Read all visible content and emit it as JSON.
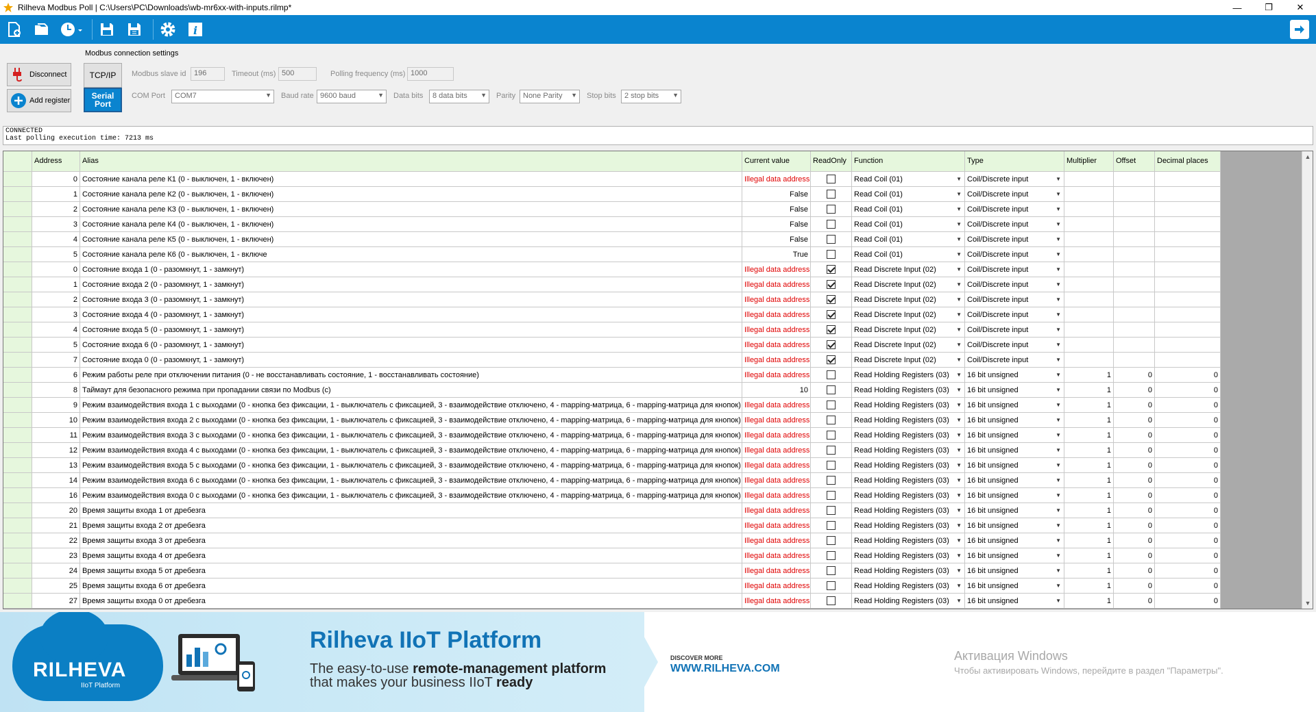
{
  "window": {
    "title": "Rilheva Modbus Poll | C:\\Users\\PC\\Downloads\\wb-mr6xx-with-inputs.rilmp*",
    "minimize": "—",
    "maximize": "❐",
    "close": "✕"
  },
  "toolbar": {
    "icons": [
      "new-document-icon",
      "open-folder-icon",
      "recent-clock-icon",
      "save-icon",
      "save-as-icon",
      "settings-gear-icon",
      "info-icon",
      "exit-arrow-icon"
    ],
    "accent": "#0a84cf"
  },
  "actions": {
    "disconnect": "Disconnect",
    "add_register": "Add register"
  },
  "connection": {
    "group_title": "Modbus connection settings",
    "tcp_ip": "TCP/IP",
    "serial_port": "Serial Port",
    "slave_id_label": "Modbus slave id",
    "slave_id_value": "196",
    "timeout_label": "Timeout (ms)",
    "timeout_value": "500",
    "polling_label": "Polling frequency (ms)",
    "polling_value": "1000",
    "com_port_label": "COM Port",
    "com_port_value": "COM7",
    "baud_label": "Baud rate",
    "baud_value": "9600 baud",
    "data_bits_label": "Data bits",
    "data_bits_value": "8 data bits",
    "parity_label": "Parity",
    "parity_value": "None Parity",
    "stop_bits_label": "Stop bits",
    "stop_bits_value": "2 stop bits"
  },
  "status": {
    "line1": "CONNECTED",
    "line2": "Last polling execution time: 7213 ms"
  },
  "grid": {
    "headers": {
      "address": "Address",
      "alias": "Alias",
      "current": "Current value",
      "readonly": "ReadOnly",
      "function": "Function",
      "type": "Type",
      "multiplier": "Multiplier",
      "offset": "Offset",
      "decimal": "Decimal places"
    },
    "rows": [
      {
        "address": "0",
        "alias": "Состояние канала реле К1 (0 - выключен, 1 - включен)",
        "value": "Illegal data address",
        "error": true,
        "readonly": false,
        "function": "Read Coil (01)",
        "type": "Coil/Discrete input",
        "multiplier": "",
        "offset": "",
        "decimal": ""
      },
      {
        "address": "1",
        "alias": "Состояние канала реле К2 (0 - выключен, 1 - включен)",
        "value": "False",
        "error": false,
        "readonly": false,
        "function": "Read Coil (01)",
        "type": "Coil/Discrete input",
        "multiplier": "",
        "offset": "",
        "decimal": ""
      },
      {
        "address": "2",
        "alias": "Состояние канала реле К3 (0 - выключен, 1 - включен)",
        "value": "False",
        "error": false,
        "readonly": false,
        "function": "Read Coil (01)",
        "type": "Coil/Discrete input",
        "multiplier": "",
        "offset": "",
        "decimal": ""
      },
      {
        "address": "3",
        "alias": "Состояние канала реле К4 (0 - выключен, 1 - включен)",
        "value": "False",
        "error": false,
        "readonly": false,
        "function": "Read Coil (01)",
        "type": "Coil/Discrete input",
        "multiplier": "",
        "offset": "",
        "decimal": ""
      },
      {
        "address": "4",
        "alias": "Состояние канала реле К5 (0 - выключен, 1 - включен)",
        "value": "False",
        "error": false,
        "readonly": false,
        "function": "Read Coil (01)",
        "type": "Coil/Discrete input",
        "multiplier": "",
        "offset": "",
        "decimal": ""
      },
      {
        "address": "5",
        "alias": "Состояние канала реле К6 (0 - выключен, 1 - включе",
        "value": "True",
        "error": false,
        "readonly": false,
        "function": "Read Coil (01)",
        "type": "Coil/Discrete input",
        "multiplier": "",
        "offset": "",
        "decimal": ""
      },
      {
        "address": "0",
        "alias": "Состояние входа 1 (0 - разомкнут, 1 - замкнут)",
        "value": "Illegal data address",
        "error": true,
        "readonly": true,
        "function": "Read Discrete Input (02)",
        "type": "Coil/Discrete input",
        "multiplier": "",
        "offset": "",
        "decimal": ""
      },
      {
        "address": "1",
        "alias": "Состояние входа 2 (0 - разомкнут, 1 - замкнут)",
        "value": "Illegal data address",
        "error": true,
        "readonly": true,
        "function": "Read Discrete Input (02)",
        "type": "Coil/Discrete input",
        "multiplier": "",
        "offset": "",
        "decimal": ""
      },
      {
        "address": "2",
        "alias": "Состояние входа 3 (0 - разомкнут, 1 - замкнут)",
        "value": "Illegal data address",
        "error": true,
        "readonly": true,
        "function": "Read Discrete Input (02)",
        "type": "Coil/Discrete input",
        "multiplier": "",
        "offset": "",
        "decimal": ""
      },
      {
        "address": "3",
        "alias": "Состояние входа 4 (0 - разомкнут, 1 - замкнут)",
        "value": "Illegal data address",
        "error": true,
        "readonly": true,
        "function": "Read Discrete Input (02)",
        "type": "Coil/Discrete input",
        "multiplier": "",
        "offset": "",
        "decimal": ""
      },
      {
        "address": "4",
        "alias": "Состояние входа 5 (0 - разомкнут, 1 - замкнут)",
        "value": "Illegal data address",
        "error": true,
        "readonly": true,
        "function": "Read Discrete Input (02)",
        "type": "Coil/Discrete input",
        "multiplier": "",
        "offset": "",
        "decimal": ""
      },
      {
        "address": "5",
        "alias": "Состояние входа 6 (0 - разомкнут, 1 - замкнут)",
        "value": "Illegal data address",
        "error": true,
        "readonly": true,
        "function": "Read Discrete Input (02)",
        "type": "Coil/Discrete input",
        "multiplier": "",
        "offset": "",
        "decimal": ""
      },
      {
        "address": "7",
        "alias": "Состояние входа 0 (0 - разомкнут, 1 - замкнут)",
        "value": "Illegal data address",
        "error": true,
        "readonly": true,
        "function": "Read Discrete Input (02)",
        "type": "Coil/Discrete input",
        "multiplier": "",
        "offset": "",
        "decimal": ""
      },
      {
        "address": "6",
        "alias": "Режим работы реле при отключении питания (0 - не восстанавливать состояние, 1 - восстанавливать состояние)",
        "value": "Illegal data address",
        "error": true,
        "readonly": false,
        "function": "Read Holding Registers (03)",
        "type": "16 bit unsigned",
        "multiplier": "1",
        "offset": "0",
        "decimal": "0"
      },
      {
        "address": "8",
        "alias": "Таймаут для безопасного режима при пропадании связи по Modbus (с)",
        "value": "10",
        "error": false,
        "readonly": false,
        "function": "Read Holding Registers (03)",
        "type": "16 bit unsigned",
        "multiplier": "1",
        "offset": "0",
        "decimal": "0"
      },
      {
        "address": "9",
        "alias": "Режим взаимодействия входа 1 с выходами (0 - кнопка без фиксации, 1 - выключатель с фиксацией, 3 - взаимодействие отключено, 4 - mapping-матрица, 6 - mapping-матрица для кнопок)",
        "value": "Illegal data address",
        "error": true,
        "readonly": false,
        "function": "Read Holding Registers (03)",
        "type": "16 bit unsigned",
        "multiplier": "1",
        "offset": "0",
        "decimal": "0"
      },
      {
        "address": "10",
        "alias": "Режим взаимодействия входа 2 с выходами (0 - кнопка без фиксации, 1 - выключатель с фиксацией, 3 - взаимодействие отключено, 4 - mapping-матрица, 6 - mapping-матрица для кнопок)",
        "value": "Illegal data address",
        "error": true,
        "readonly": false,
        "function": "Read Holding Registers (03)",
        "type": "16 bit unsigned",
        "multiplier": "1",
        "offset": "0",
        "decimal": "0"
      },
      {
        "address": "11",
        "alias": "Режим взаимодействия входа 3 с выходами (0 - кнопка без фиксации, 1 - выключатель с фиксацией, 3 - взаимодействие отключено, 4 - mapping-матрица, 6 - mapping-матрица для кнопок)",
        "value": "Illegal data address",
        "error": true,
        "readonly": false,
        "function": "Read Holding Registers (03)",
        "type": "16 bit unsigned",
        "multiplier": "1",
        "offset": "0",
        "decimal": "0"
      },
      {
        "address": "12",
        "alias": "Режим взаимодействия входа 4 с выходами (0 - кнопка без фиксации, 1 - выключатель с фиксацией, 3 - взаимодействие отключено, 4 - mapping-матрица, 6 - mapping-матрица для кнопок)",
        "value": "Illegal data address",
        "error": true,
        "readonly": false,
        "function": "Read Holding Registers (03)",
        "type": "16 bit unsigned",
        "multiplier": "1",
        "offset": "0",
        "decimal": "0"
      },
      {
        "address": "13",
        "alias": "Режим взаимодействия входа 5 с выходами (0 - кнопка без фиксации, 1 - выключатель с фиксацией, 3 - взаимодействие отключено, 4 - mapping-матрица, 6 - mapping-матрица для кнопок)",
        "value": "Illegal data address",
        "error": true,
        "readonly": false,
        "function": "Read Holding Registers (03)",
        "type": "16 bit unsigned",
        "multiplier": "1",
        "offset": "0",
        "decimal": "0"
      },
      {
        "address": "14",
        "alias": "Режим взаимодействия входа 6 с выходами (0 - кнопка без фиксации, 1 - выключатель с фиксацией, 3 - взаимодействие отключено, 4 - mapping-матрица, 6 - mapping-матрица для кнопок)",
        "value": "Illegal data address",
        "error": true,
        "readonly": false,
        "function": "Read Holding Registers (03)",
        "type": "16 bit unsigned",
        "multiplier": "1",
        "offset": "0",
        "decimal": "0"
      },
      {
        "address": "16",
        "alias": "Режим взаимодействия входа 0 с выходами (0 - кнопка без фиксации, 1 - выключатель с фиксацией, 3 - взаимодействие отключено, 4 - mapping-матрица, 6 - mapping-матрица для кнопок)",
        "value": "Illegal data address",
        "error": true,
        "readonly": false,
        "function": "Read Holding Registers (03)",
        "type": "16 bit unsigned",
        "multiplier": "1",
        "offset": "0",
        "decimal": "0"
      },
      {
        "address": "20",
        "alias": "Время защиты входа 1 от дребезга",
        "value": "Illegal data address",
        "error": true,
        "readonly": false,
        "function": "Read Holding Registers (03)",
        "type": "16 bit unsigned",
        "multiplier": "1",
        "offset": "0",
        "decimal": "0"
      },
      {
        "address": "21",
        "alias": "Время защиты входа 2 от дребезга",
        "value": "Illegal data address",
        "error": true,
        "readonly": false,
        "function": "Read Holding Registers (03)",
        "type": "16 bit unsigned",
        "multiplier": "1",
        "offset": "0",
        "decimal": "0"
      },
      {
        "address": "22",
        "alias": "Время защиты входа 3 от дребезга",
        "value": "Illegal data address",
        "error": true,
        "readonly": false,
        "function": "Read Holding Registers (03)",
        "type": "16 bit unsigned",
        "multiplier": "1",
        "offset": "0",
        "decimal": "0"
      },
      {
        "address": "23",
        "alias": "Время защиты входа 4 от дребезга",
        "value": "Illegal data address",
        "error": true,
        "readonly": false,
        "function": "Read Holding Registers (03)",
        "type": "16 bit unsigned",
        "multiplier": "1",
        "offset": "0",
        "decimal": "0"
      },
      {
        "address": "24",
        "alias": "Время защиты входа 5 от дребезга",
        "value": "Illegal data address",
        "error": true,
        "readonly": false,
        "function": "Read Holding Registers (03)",
        "type": "16 bit unsigned",
        "multiplier": "1",
        "offset": "0",
        "decimal": "0"
      },
      {
        "address": "25",
        "alias": "Время защиты входа 6 от дребезга",
        "value": "Illegal data address",
        "error": true,
        "readonly": false,
        "function": "Read Holding Registers (03)",
        "type": "16 bit unsigned",
        "multiplier": "1",
        "offset": "0",
        "decimal": "0"
      },
      {
        "address": "27",
        "alias": "Время защиты входа 0 от дребезга",
        "value": "Illegal data address",
        "error": true,
        "readonly": false,
        "function": "Read Holding Registers (03)",
        "type": "16 bit unsigned",
        "multiplier": "1",
        "offset": "0",
        "decimal": "0"
      }
    ]
  },
  "banner": {
    "logo_name": "RILHEVA",
    "logo_sub": "IIoT Platform",
    "title": "Rilheva IIoT Platform",
    "tag1_pre": "The easy-to-use ",
    "tag1_bold": "remote-management platform",
    "tag2_pre": "that makes your business IIoT ",
    "tag2_bold": "ready",
    "discover": "DISCOVER MORE",
    "url": "WWW.RILHEVA.COM"
  },
  "watermark": {
    "line1": "Активация Windows",
    "line2": "Чтобы активировать Windows, перейдите в раздел \"Параметры\"."
  }
}
